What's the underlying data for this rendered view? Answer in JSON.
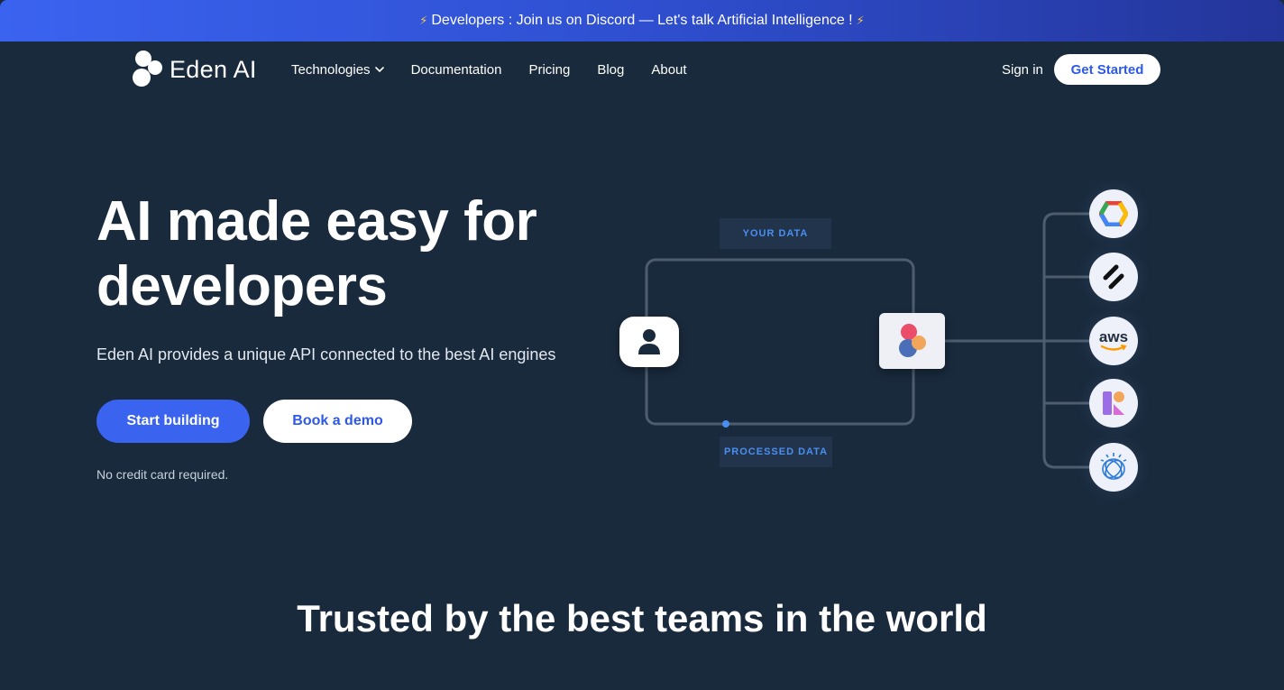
{
  "announcement": {
    "text": "Developers : Join us on Discord — Let's talk Artificial Intelligence !",
    "bolt_color": "#f7c948"
  },
  "brand": {
    "name": "Eden AI"
  },
  "nav": {
    "items": [
      {
        "label": "Technologies",
        "has_dropdown": true
      },
      {
        "label": "Documentation"
      },
      {
        "label": "Pricing"
      },
      {
        "label": "Blog"
      },
      {
        "label": "About"
      }
    ],
    "sign_in": "Sign in",
    "get_started": "Get Started"
  },
  "hero": {
    "title_line1": "AI made easy for",
    "title_line2": "developers",
    "subtitle": "Eden AI provides a unique API connected to the best AI engines",
    "primary_cta": "Start building",
    "secondary_cta": "Book a demo",
    "note": "No credit card required."
  },
  "diagram": {
    "your_data": "YOUR DATA",
    "processed_data": "PROCESSED DATA",
    "providers": [
      {
        "icon": "google-cloud-icon"
      },
      {
        "icon": "slash-provider-icon"
      },
      {
        "icon": "aws-icon",
        "label": "aws"
      },
      {
        "icon": "microsoft-azure-icon"
      },
      {
        "icon": "ibm-watson-icon"
      }
    ]
  },
  "trusted": {
    "title": "Trusted by the best teams in the world"
  },
  "colors": {
    "background": "#192a3d",
    "accent": "#3a63f0",
    "tag_text": "#4a8ff0"
  }
}
